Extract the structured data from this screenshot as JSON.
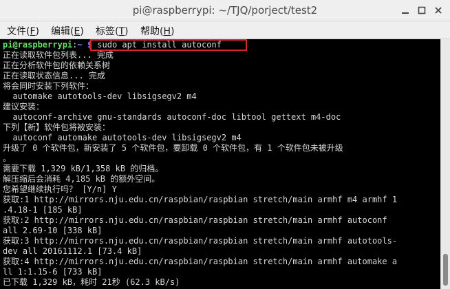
{
  "window": {
    "title": "pi@raspberrypi: ~/TJQ/porject/test2"
  },
  "menu": [
    {
      "label": "文件(",
      "key": "F",
      "end": ")"
    },
    {
      "label": "编辑(",
      "key": "E",
      "end": ")"
    },
    {
      "label": "标签(",
      "key": "T",
      "end": ")"
    },
    {
      "label": "帮助(",
      "key": "H",
      "end": ")"
    }
  ],
  "terminal": {
    "prompt": {
      "user": "pi@raspberrypi",
      "sep": ":",
      "path": "~ $",
      "command": " sudo apt install autoconf"
    },
    "lines": [
      "正在读取软件包列表... 完成",
      "正在分析软件包的依赖关系树",
      "正在读取状态信息... 完成",
      "将会同时安装下列软件：",
      "  automake autotools-dev libsigsegv2 m4",
      "建议安装：",
      "  autoconf-archive gnu-standards autoconf-doc libtool gettext m4-doc",
      "下列【新】软件包将被安装：",
      "  autoconf automake autotools-dev libsigsegv2 m4",
      "升级了 0 个软件包，新安装了 5 个软件包，要卸载 0 个软件包，有 1 个软件包未被升级",
      "。",
      "需要下载 1,329 kB/1,358 kB 的归档。",
      "解压缩后会消耗 4,185 kB 的额外空间。",
      "您希望继续执行吗？ [Y/n] Y",
      "获取:1 http://mirrors.nju.edu.cn/raspbian/raspbian stretch/main armhf m4 armhf 1",
      ".4.18-1 [185 kB]",
      "获取:2 http://mirrors.nju.edu.cn/raspbian/raspbian stretch/main armhf autoconf",
      "all 2.69-10 [338 kB]",
      "获取:3 http://mirrors.nju.edu.cn/raspbian/raspbian stretch/main armhf autotools-",
      "dev all 20161112.1 [73.4 kB]",
      "获取:4 http://mirrors.nju.edu.cn/raspbian/raspbian stretch/main armhf automake a",
      "ll 1:1.15-6 [733 kB]",
      "已下载 1,329 kB，耗时 21秒 (62.3 kB/s)"
    ]
  }
}
